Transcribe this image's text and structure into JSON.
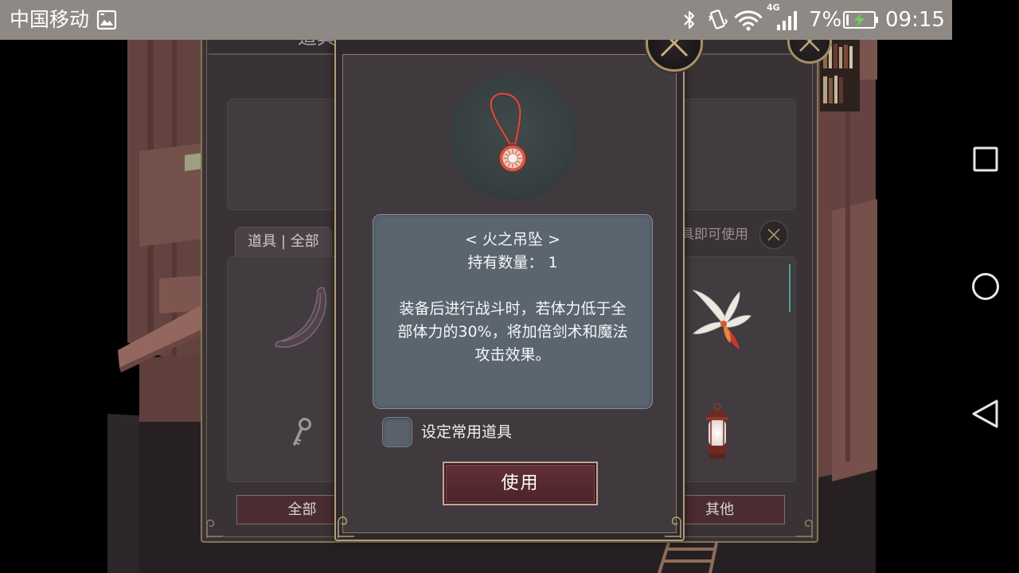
{
  "status_bar": {
    "carrier": "中国移动",
    "network_type": "4G",
    "battery": "7%",
    "time": "09:15",
    "icons": {
      "notification": "image-icon",
      "bluetooth": "bluetooth-icon",
      "vibrate": "vibrate-icon",
      "wifi": "wifi-icon",
      "signal": "cellular-signal-icon",
      "battery": "battery-charging-icon"
    }
  },
  "nav_bar": {
    "icons": [
      "recents-icon",
      "home-icon",
      "back-icon"
    ]
  },
  "inventory": {
    "title": "道具探",
    "tab": "道具 | 全部",
    "hint": "点击道具即可使用",
    "bottom_tabs": [
      "全部",
      "其他"
    ],
    "items": [
      "horn-item-icon",
      "key-item-icon",
      "feather-item-icon",
      "lantern-item-icon"
    ],
    "close_icon": "close-icon"
  },
  "item_detail": {
    "icon": "fire-pendant-icon",
    "name": "< 火之吊坠 >",
    "quantity": "持有数量： 1",
    "description_lines": [
      "装备后进行战斗时，若体力低于全",
      "部体力的30%，将加倍剑术和魔法",
      "攻击效果。"
    ],
    "favorite_label": "设定常用道具",
    "favorite_checked": false,
    "use_button": "使用",
    "close_icon": "close-icon"
  },
  "colors": {
    "status_bar": "#8e8985",
    "panel": "#3a3336",
    "dialog": "#403a3e",
    "gold_trim": "#b19e77",
    "description_box": "#5b6570",
    "use_button": "#4b2228",
    "scroll_indicator": "#4aa595"
  }
}
